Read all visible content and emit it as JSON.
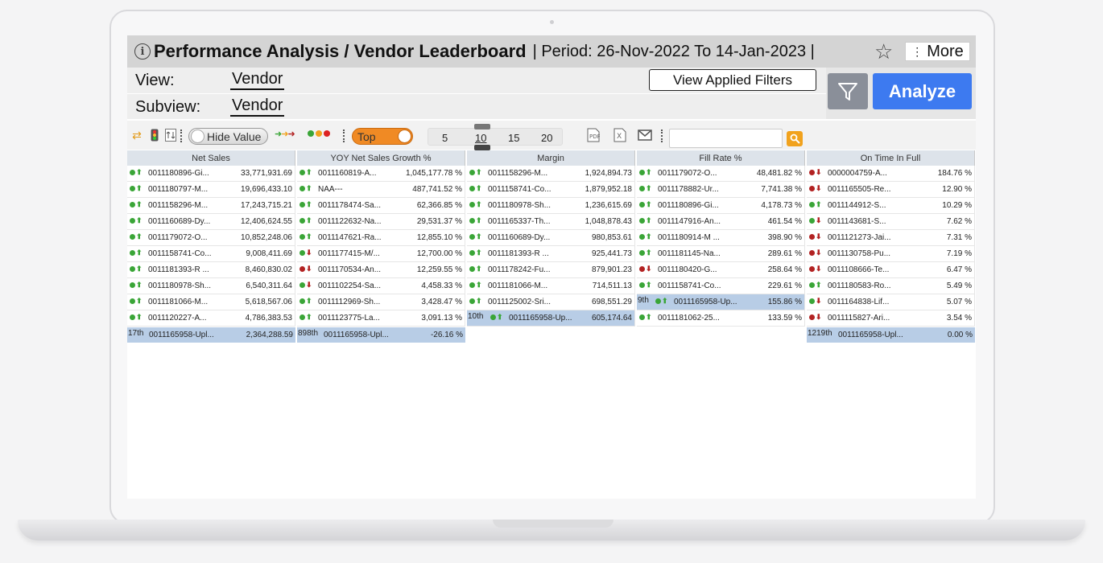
{
  "colors": {
    "up_green": "#3aa537",
    "down_red": "#b22222",
    "accent": "#3d7af0",
    "highlight": "#b8cde6",
    "orange": "#f08a24"
  },
  "header": {
    "title": "Performance Analysis / Vendor Leaderboard",
    "period": "| Period: 26-Nov-2022 To 14-Jan-2023 |",
    "more_label": "More"
  },
  "view": {
    "label": "View:",
    "value": "Vendor"
  },
  "subview": {
    "label": "Subview:",
    "value": "Vendor"
  },
  "buttons": {
    "applied_filters": "View Applied Filters",
    "analyze": "Analyze"
  },
  "toolbar": {
    "hide_value": "Hide Value",
    "top_label": "Top",
    "slider_ticks": [
      "5",
      "10",
      "15",
      "20"
    ],
    "slider_value": "10",
    "search_value": ""
  },
  "columns": [
    {
      "header": "Net Sales",
      "rows": [
        {
          "d": "up",
          "name": "0011180896-Gi...",
          "value": "33,771,931.69"
        },
        {
          "d": "up",
          "name": "0011180797-M...",
          "value": "19,696,433.10"
        },
        {
          "d": "up",
          "name": "0011158296-M...",
          "value": "17,243,715.21"
        },
        {
          "d": "up",
          "name": "0011160689-Dy...",
          "value": "12,406,624.55"
        },
        {
          "d": "up",
          "name": "0011179072-O...",
          "value": "10,852,248.06"
        },
        {
          "d": "up",
          "name": "0011158741-Co...",
          "value": "9,008,411.69"
        },
        {
          "d": "up",
          "name": "0011181393-R ...",
          "value": "8,460,830.02"
        },
        {
          "d": "up",
          "name": "0011180978-Sh...",
          "value": "6,540,311.64"
        },
        {
          "d": "up",
          "name": "0011181066-M...",
          "value": "5,618,567.06"
        },
        {
          "d": "up",
          "name": "0011120227-A...",
          "value": "4,786,383.53"
        }
      ],
      "footer": {
        "rank": "17th",
        "name": "0011165958-Upl...",
        "value": "2,364,288.59"
      }
    },
    {
      "header": "YOY Net Sales Growth %",
      "rows": [
        {
          "d": "up",
          "name": "0011160819-A...",
          "value": "1,045,177.78 %"
        },
        {
          "d": "up",
          "name": "NAA---",
          "value": "487,741.52 %"
        },
        {
          "d": "up",
          "name": "0011178474-Sa...",
          "value": "62,366.85 %"
        },
        {
          "d": "up",
          "name": "0011122632-Na...",
          "value": "29,531.37 %"
        },
        {
          "d": "up",
          "name": "0011147621-Ra...",
          "value": "12,855.10 %"
        },
        {
          "d": "gd",
          "name": "0011177415-M/...",
          "value": "12,700.00 %"
        },
        {
          "d": "down",
          "name": "0011170534-An...",
          "value": "12,259.55 %"
        },
        {
          "d": "gd",
          "name": "0011102254-Sa...",
          "value": "4,458.33 %"
        },
        {
          "d": "up",
          "name": "0011112969-Sh...",
          "value": "3,428.47 %"
        },
        {
          "d": "up",
          "name": "0011123775-La...",
          "value": "3,091.13 %"
        }
      ],
      "footer": {
        "rank": "898th",
        "name": "0011165958-Upl...",
        "value": "-26.16 %"
      }
    },
    {
      "header": "Margin",
      "rows": [
        {
          "d": "up",
          "name": "0011158296-M...",
          "value": "1,924,894.73"
        },
        {
          "d": "up",
          "name": "0011158741-Co...",
          "value": "1,879,952.18"
        },
        {
          "d": "up",
          "name": "0011180978-Sh...",
          "value": "1,236,615.69"
        },
        {
          "d": "up",
          "name": "0011165337-Th...",
          "value": "1,048,878.43"
        },
        {
          "d": "up",
          "name": "0011160689-Dy...",
          "value": "980,853.61"
        },
        {
          "d": "up",
          "name": "0011181393-R ...",
          "value": "925,441.73"
        },
        {
          "d": "up",
          "name": "0011178242-Fu...",
          "value": "879,901.23"
        },
        {
          "d": "up",
          "name": "0011181066-M...",
          "value": "714,511.13"
        },
        {
          "d": "up",
          "name": "0011125002-Sri...",
          "value": "698,551.29"
        },
        {
          "d": "up",
          "name": "0011165958-Up...",
          "value": "605,174.64",
          "rank": "10th",
          "hl": true
        }
      ],
      "footer": null
    },
    {
      "header": "Fill Rate %",
      "rows": [
        {
          "d": "up",
          "name": "0011179072-O...",
          "value": "48,481.82 %"
        },
        {
          "d": "up",
          "name": "0011178882-Ur...",
          "value": "7,741.38 %"
        },
        {
          "d": "up",
          "name": "0011180896-Gi...",
          "value": "4,178.73 %"
        },
        {
          "d": "up",
          "name": "0011147916-An...",
          "value": "461.54 %"
        },
        {
          "d": "up",
          "name": "0011180914-M ...",
          "value": "398.90 %"
        },
        {
          "d": "up",
          "name": "0011181145-Na...",
          "value": "289.61 %"
        },
        {
          "d": "down",
          "name": "0011180420-G...",
          "value": "258.64 %"
        },
        {
          "d": "up",
          "name": "0011158741-Co...",
          "value": "229.61 %"
        },
        {
          "d": "up",
          "name": "0011165958-Up...",
          "value": "155.86 %",
          "rank": "9th",
          "hl": true
        },
        {
          "d": "up",
          "name": "0011181062-25...",
          "value": "133.59 %"
        }
      ],
      "footer": null
    },
    {
      "header": "On Time In Full",
      "rows": [
        {
          "d": "down",
          "name": "0000004759-A...",
          "value": "184.76 %"
        },
        {
          "d": "down",
          "name": "0011165505-Re...",
          "value": "12.90 %"
        },
        {
          "d": "up",
          "name": "0011144912-S...",
          "value": "10.29 %"
        },
        {
          "d": "gd",
          "name": "0011143681-S...",
          "value": "7.62 %"
        },
        {
          "d": "down",
          "name": "0011121273-Jai...",
          "value": "7.31 %"
        },
        {
          "d": "down",
          "name": "0011130758-Pu...",
          "value": "7.19 %"
        },
        {
          "d": "down",
          "name": "0011108666-Te...",
          "value": "6.47 %"
        },
        {
          "d": "up",
          "name": "0011180583-Ro...",
          "value": "5.49 %"
        },
        {
          "d": "gd",
          "name": "0011164838-Lif...",
          "value": "5.07 %"
        },
        {
          "d": "down",
          "name": "0011115827-Ari...",
          "value": "3.54 %"
        }
      ],
      "footer": {
        "rank": "1219th",
        "name": "0011165958-Upl...",
        "value": "0.00 %"
      }
    }
  ]
}
